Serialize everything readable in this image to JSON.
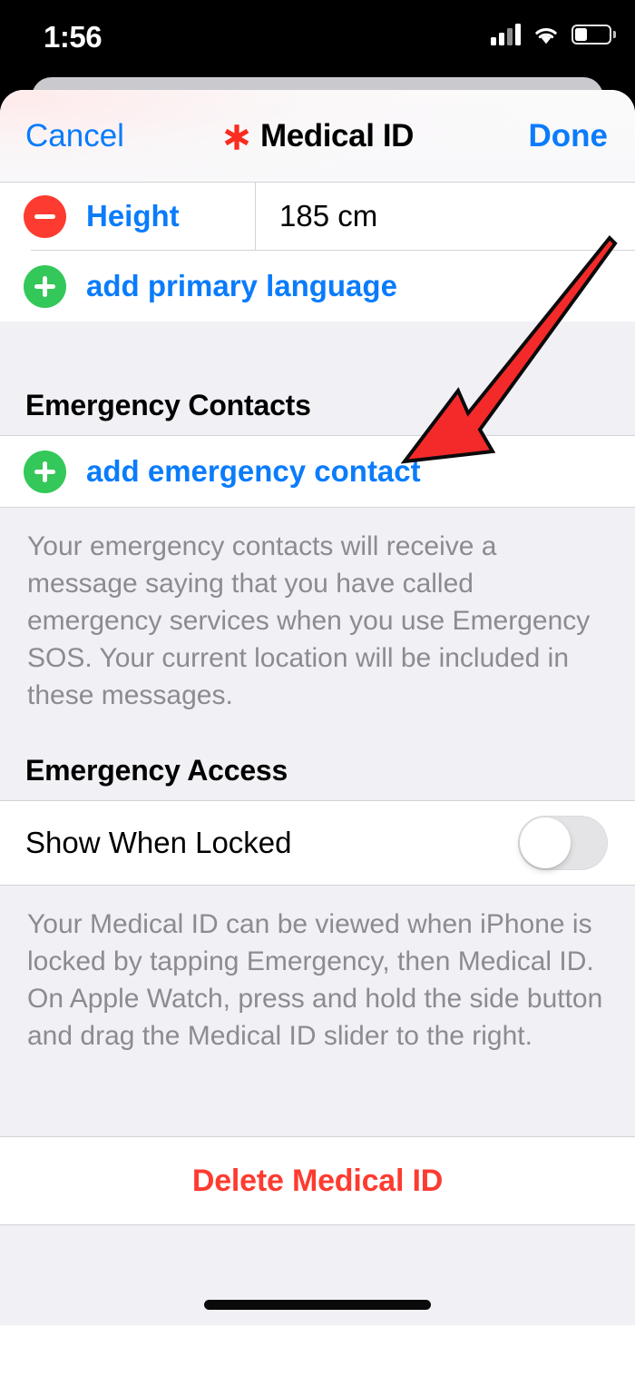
{
  "status_bar": {
    "time": "1:56",
    "cellular_icon": "cellular-bars-icon",
    "wifi_icon": "wifi-icon",
    "battery_icon": "battery-icon"
  },
  "navbar": {
    "cancel_label": "Cancel",
    "title": "Medical ID",
    "title_icon": "medical-id-asterisk-icon",
    "done_label": "Done",
    "accent_color": "#0a7cfb"
  },
  "fields_section": {
    "height_row": {
      "action_icon": "minus-circle-icon",
      "label": "Height",
      "value": "185 cm"
    },
    "add_language_row": {
      "action_icon": "plus-circle-icon",
      "label": "add primary language"
    }
  },
  "emergency_contacts": {
    "header": "Emergency Contacts",
    "add_row": {
      "action_icon": "plus-circle-icon",
      "label": "add emergency contact"
    },
    "footnote": "Your emergency contacts will receive a message saying that you have called emergency services when you use Emergency SOS. Your current location will be included in these messages."
  },
  "emergency_access": {
    "header": "Emergency Access",
    "toggle_label": "Show When Locked",
    "toggle_state": "off",
    "footnote": "Your Medical ID can be viewed when iPhone is locked by tapping Emergency, then Medical ID. On Apple Watch, press and hold the side button and drag the Medical ID slider to the right."
  },
  "delete_section": {
    "label": "Delete Medical ID",
    "color": "#fd3b30"
  },
  "annotation": {
    "arrow_icon": "red-pointer-arrow-icon",
    "color": "#f42a2a",
    "points_to": "add emergency contact"
  },
  "home_indicator": "home-indicator"
}
